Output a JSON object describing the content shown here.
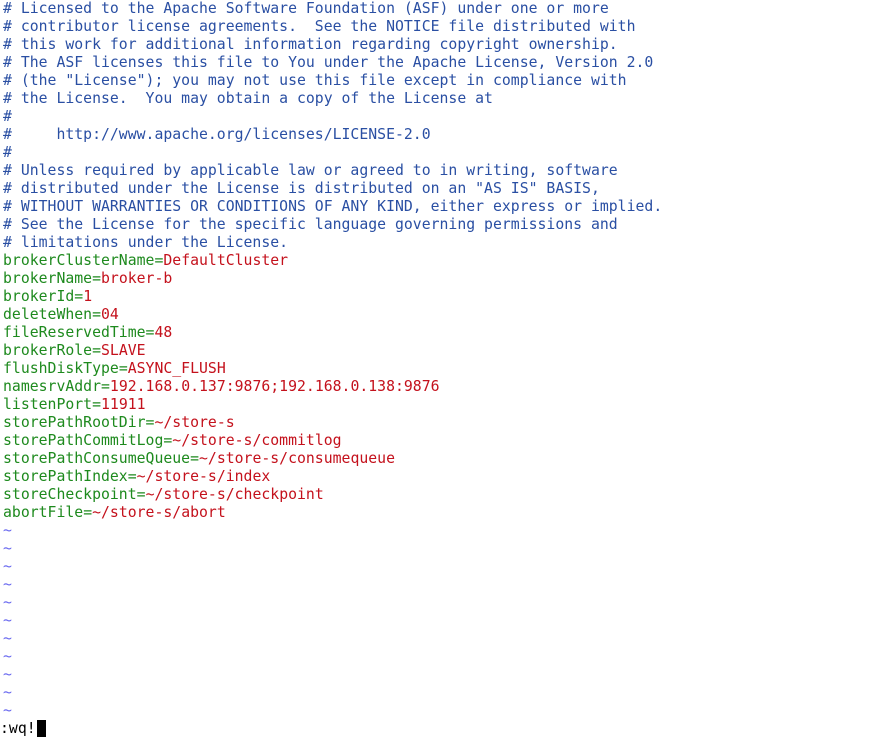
{
  "comments": [
    "# Licensed to the Apache Software Foundation (ASF) under one or more",
    "# contributor license agreements.  See the NOTICE file distributed with",
    "# this work for additional information regarding copyright ownership.",
    "# The ASF licenses this file to You under the Apache License, Version 2.0",
    "# (the \"License\"); you may not use this file except in compliance with",
    "# the License.  You may obtain a copy of the License at",
    "#",
    "#     http://www.apache.org/licenses/LICENSE-2.0",
    "#",
    "# Unless required by applicable law or agreed to in writing, software",
    "# distributed under the License is distributed on an \"AS IS\" BASIS,",
    "# WITHOUT WARRANTIES OR CONDITIONS OF ANY KIND, either express or implied.",
    "# See the License for the specific language governing permissions and",
    "# limitations under the License."
  ],
  "config": [
    {
      "key": "brokerClusterName",
      "value": "DefaultCluster"
    },
    {
      "key": "brokerName",
      "value": "broker-b"
    },
    {
      "key": "brokerId",
      "value": "1"
    },
    {
      "key": "deleteWhen",
      "value": "04"
    },
    {
      "key": "fileReservedTime",
      "value": "48"
    },
    {
      "key": "brokerRole",
      "value": "SLAVE"
    },
    {
      "key": "flushDiskType",
      "value": "ASYNC_FLUSH"
    },
    {
      "key": "namesrvAddr",
      "value": "192.168.0.137:9876;192.168.0.138:9876"
    },
    {
      "key": "listenPort",
      "value": "11911"
    },
    {
      "key": "storePathRootDir",
      "value": "~/store-s"
    },
    {
      "key": "storePathCommitLog",
      "value": "~/store-s/commitlog"
    },
    {
      "key": "storePathConsumeQueue",
      "value": "~/store-s/consumequeue"
    },
    {
      "key": "storePathIndex",
      "value": "~/store-s/index"
    },
    {
      "key": "storeCheckpoint",
      "value": "~/store-s/checkpoint"
    },
    {
      "key": "abortFile",
      "value": "~/store-s/abort"
    }
  ],
  "equals_sign": "=",
  "tilde": "~",
  "empty_line_count": 11,
  "command_line": ":wq!",
  "colors": {
    "comment": "#2a4fa3",
    "key": "#1e8a1e",
    "value": "#c4111c",
    "tilde": "#6a6af0"
  }
}
